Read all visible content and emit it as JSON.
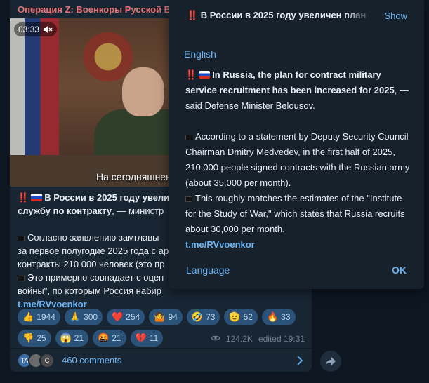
{
  "post": {
    "channel_name": "Операция Z: Военкоры Русской В",
    "video": {
      "duration": "03:33",
      "subtitle": "На сегодняшнен"
    },
    "text": {
      "title_mark": "‼️",
      "title_bold": "В России в 2025 году увели",
      "title_bold2": "службу по контракту",
      "title_rest": ", — министр",
      "p1_l1": "Согласно заявлению замглавы",
      "p1_l2": "за первое полугодие 2025 года с ар",
      "p1_l3": "контракты 210 000 человек (это пр",
      "p2_l1": "Это примерно совпадает с оцен",
      "p2_l2": "войны\", по которым Россия набир",
      "link": "t.me/RVvoenkor"
    },
    "reactions": [
      {
        "emoji": "👍",
        "count": "1944"
      },
      {
        "emoji": "🙏",
        "count": "300"
      },
      {
        "emoji": "❤️",
        "count": "254"
      },
      {
        "emoji": "🤷",
        "count": "94"
      },
      {
        "emoji": "🤣",
        "count": "73"
      },
      {
        "emoji": "🫡",
        "count": "52"
      },
      {
        "emoji": "🔥",
        "count": "33"
      },
      {
        "emoji": "👎",
        "count": "25"
      },
      {
        "emoji": "😱",
        "count": "21"
      },
      {
        "emoji": "🤬",
        "count": "21"
      },
      {
        "emoji": "💔",
        "count": "11"
      }
    ],
    "views": "124.2K",
    "edited": "edited 19:31",
    "comments": {
      "avatars": [
        "TA",
        "",
        "C"
      ],
      "label": "460 comments"
    }
  },
  "popup": {
    "header_title": "‼️ В России в 2025 году увеличен план",
    "show": "Show",
    "language_label": "English",
    "body": {
      "title_bold": "In Russia, the plan for contract military service recruitment has been increased for 2025",
      "title_rest": ", — said Defense Minister Belousov.",
      "p1": "According to a statement by Deputy Security Council Chairman Dmitry Medvedev, in the first half of 2025, 210,000 people signed contracts with the Russian army (about 35,000 per month).",
      "p2": "This roughly matches the estimates of the \"Institute for the Study of War,\" which states that Russia recruits about 30,000 per month.",
      "link": "t.me/RVvoenkor"
    },
    "footer_language": "Language",
    "ok": "OK"
  }
}
